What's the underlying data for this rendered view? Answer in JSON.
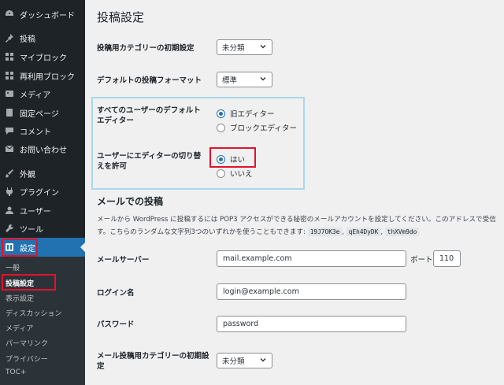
{
  "sidebar": {
    "items": [
      {
        "label": "ダッシュボード",
        "icon": "dashboard-icon"
      },
      {
        "label": "投稿",
        "icon": "pin-icon"
      },
      {
        "label": "マイブロック",
        "icon": "blocks-icon"
      },
      {
        "label": "再利用ブロック",
        "icon": "blocks-icon"
      },
      {
        "label": "メディア",
        "icon": "media-icon"
      },
      {
        "label": "固定ページ",
        "icon": "page-icon"
      },
      {
        "label": "コメント",
        "icon": "comment-icon"
      },
      {
        "label": "お問い合わせ",
        "icon": "mail-icon"
      },
      {
        "label": "外観",
        "icon": "brush-icon"
      },
      {
        "label": "プラグイン",
        "icon": "plugin-icon"
      },
      {
        "label": "ユーザー",
        "icon": "user-icon"
      },
      {
        "label": "ツール",
        "icon": "wrench-icon"
      },
      {
        "label": "設定",
        "icon": "settings-icon"
      }
    ],
    "submenu": [
      "一般",
      "投稿設定",
      "表示設定",
      "ディスカッション",
      "メディア",
      "パーマリンク",
      "プライバシー",
      "TOC+"
    ]
  },
  "main": {
    "title": "投稿設定",
    "default_category": {
      "label": "投稿用カテゴリーの初期設定",
      "value": "未分類"
    },
    "default_format": {
      "label": "デフォルトの投稿フォーマット",
      "value": "標準"
    },
    "default_editor": {
      "label": "すべてのユーザーのデフォルトエディター",
      "options": [
        "旧エディター",
        "ブロックエディター"
      ],
      "selected": "旧エディター"
    },
    "allow_switch": {
      "label": "ユーザーにエディターの切り替えを許可",
      "options": [
        "はい",
        "いいえ"
      ],
      "selected": "はい"
    },
    "mail_section": {
      "title": "メールでの投稿",
      "desc_line1": "メールから WordPress に投稿するには POP3 アクセスができる秘密のメールアカウントを設定してください。このアドレスで受信",
      "desc_line2": "す。こちらのランダムな文字列3つのいずれかを使うこともできます:",
      "codes": [
        "19J7OK3e",
        "qEh4DyDK",
        "thXVm9do"
      ]
    },
    "mail_server": {
      "label": "メールサーバー",
      "value": "mail.example.com",
      "port_label": "ポート",
      "port_value": "110"
    },
    "login_name": {
      "label": "ログイン名",
      "value": "login@example.com"
    },
    "password": {
      "label": "パスワード",
      "value": "password"
    },
    "mail_category": {
      "label": "メール投稿用カテゴリーの初期設定",
      "value": "未分類"
    }
  },
  "colors": {
    "sidebar_bg": "#1d2327",
    "active": "#2271b1",
    "highlight_red": "#e3122c",
    "highlight_blue": "#a8d8ea"
  }
}
